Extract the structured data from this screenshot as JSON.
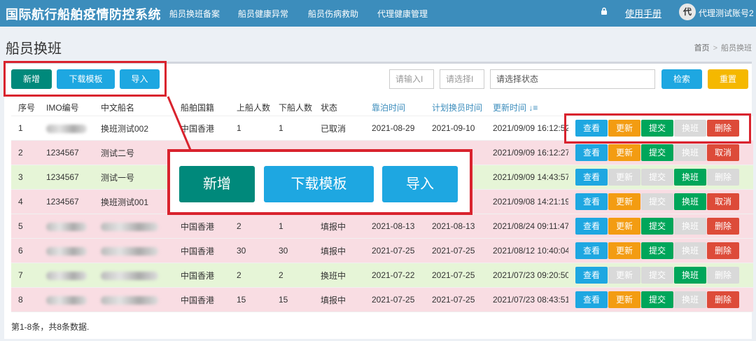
{
  "app": {
    "brand": "国际航行船舶疫情防控系统",
    "nav": [
      "船员换班备案",
      "船员健康异常",
      "船员伤病救助",
      "代理健康管理"
    ],
    "manual": "使用手册",
    "avatar_char": "代",
    "username": "代理测试账号2",
    "header_color": "#3c8dbc"
  },
  "page": {
    "title": "船员换班",
    "breadcrumb": [
      "首页",
      "船员换班"
    ],
    "breadcrumb_sep": ">"
  },
  "toolbar": {
    "add": "新增",
    "download": "下载模板",
    "import": "导入",
    "input1_placeholder": "请输入I",
    "input2_placeholder": "请选择I",
    "status_placeholder": "请选择状态",
    "search": "检索",
    "reset": "重置"
  },
  "table": {
    "headers": [
      "序号",
      "IMO编号",
      "中文船名",
      "船舶国籍",
      "上船人数",
      "下船人数",
      "状态",
      "靠泊时间",
      "计划换员时间",
      "更新时间",
      ""
    ],
    "sort_icon": "↓≡",
    "rows": [
      {
        "no": "1",
        "imo": "",
        "imo_blur": true,
        "name": "换班测试002",
        "flag": "中国香港",
        "on": "1",
        "off": "1",
        "status": "已取消",
        "berth": "2021-08-29",
        "plan": "2021-09-10",
        "updated": "2021/09/09 16:12:52",
        "style": "white",
        "actions": [
          [
            "查看",
            "sky"
          ],
          [
            "更新",
            "orange"
          ],
          [
            "提交",
            "green"
          ],
          [
            "换班",
            "gray"
          ],
          [
            "删除",
            "red"
          ]
        ]
      },
      {
        "no": "2",
        "imo": "1234567",
        "name": "测试二号",
        "flag": "",
        "on": "",
        "off": "",
        "status": "",
        "berth": "",
        "plan": "",
        "updated": "2021/09/09 16:12:27",
        "style": "pink",
        "actions": [
          [
            "查看",
            "sky"
          ],
          [
            "更新",
            "orange"
          ],
          [
            "提交",
            "green"
          ],
          [
            "换班",
            "gray"
          ],
          [
            "取消",
            "red"
          ]
        ]
      },
      {
        "no": "3",
        "imo": "1234567",
        "name": "测试一号",
        "flag": "",
        "on": "",
        "off": "",
        "status": "",
        "berth": "",
        "plan": "",
        "updated": "2021/09/09 14:43:57",
        "style": "green",
        "actions": [
          [
            "查看",
            "sky"
          ],
          [
            "更新",
            "gray"
          ],
          [
            "提交",
            "gray"
          ],
          [
            "换班",
            "green"
          ],
          [
            "删除",
            "gray"
          ]
        ]
      },
      {
        "no": "4",
        "imo": "1234567",
        "name": "换班测试001",
        "flag": "",
        "on": "",
        "off": "",
        "status": "",
        "berth": "",
        "plan": "",
        "updated": "2021/09/08 14:21:19",
        "style": "pink",
        "actions": [
          [
            "查看",
            "sky"
          ],
          [
            "更新",
            "orange"
          ],
          [
            "提交",
            "gray"
          ],
          [
            "换班",
            "green"
          ],
          [
            "取消",
            "red"
          ]
        ]
      },
      {
        "no": "5",
        "imo": "",
        "imo_blur": true,
        "name": "",
        "name_blur": true,
        "flag": "中国香港",
        "on": "2",
        "off": "1",
        "status": "填报中",
        "berth": "2021-08-13",
        "plan": "2021-08-13",
        "updated": "2021/08/24 09:11:47",
        "style": "pink",
        "actions": [
          [
            "查看",
            "sky"
          ],
          [
            "更新",
            "orange"
          ],
          [
            "提交",
            "green"
          ],
          [
            "换班",
            "gray"
          ],
          [
            "删除",
            "red"
          ]
        ]
      },
      {
        "no": "6",
        "imo": "",
        "imo_blur": true,
        "name": "",
        "name_blur": true,
        "flag": "中国香港",
        "on": "30",
        "off": "30",
        "status": "填报中",
        "berth": "2021-07-25",
        "plan": "2021-07-25",
        "updated": "2021/08/12 10:40:04",
        "style": "pink",
        "actions": [
          [
            "查看",
            "sky"
          ],
          [
            "更新",
            "orange"
          ],
          [
            "提交",
            "green"
          ],
          [
            "换班",
            "gray"
          ],
          [
            "删除",
            "red"
          ]
        ]
      },
      {
        "no": "7",
        "imo": "",
        "imo_blur": true,
        "name": "",
        "name_blur": true,
        "flag": "中国香港",
        "on": "2",
        "off": "2",
        "status": "换班中",
        "berth": "2021-07-22",
        "plan": "2021-07-25",
        "updated": "2021/07/23 09:20:50",
        "style": "green",
        "actions": [
          [
            "查看",
            "sky"
          ],
          [
            "更新",
            "gray"
          ],
          [
            "提交",
            "gray"
          ],
          [
            "换班",
            "green"
          ],
          [
            "删除",
            "gray"
          ]
        ]
      },
      {
        "no": "8",
        "imo": "",
        "imo_blur": true,
        "name": "",
        "name_blur": true,
        "flag": "中国香港",
        "on": "15",
        "off": "15",
        "status": "填报中",
        "berth": "2021-07-25",
        "plan": "2021-07-25",
        "updated": "2021/07/23 08:43:51",
        "style": "pink",
        "actions": [
          [
            "查看",
            "sky"
          ],
          [
            "更新",
            "orange"
          ],
          [
            "提交",
            "green"
          ],
          [
            "换班",
            "gray"
          ],
          [
            "删除",
            "red"
          ]
        ]
      }
    ]
  },
  "footer": "第1-8条，共8条数据.",
  "callout": {
    "add": "新增",
    "download": "下载模板",
    "import": "导入",
    "border_color": "#d9232e"
  }
}
